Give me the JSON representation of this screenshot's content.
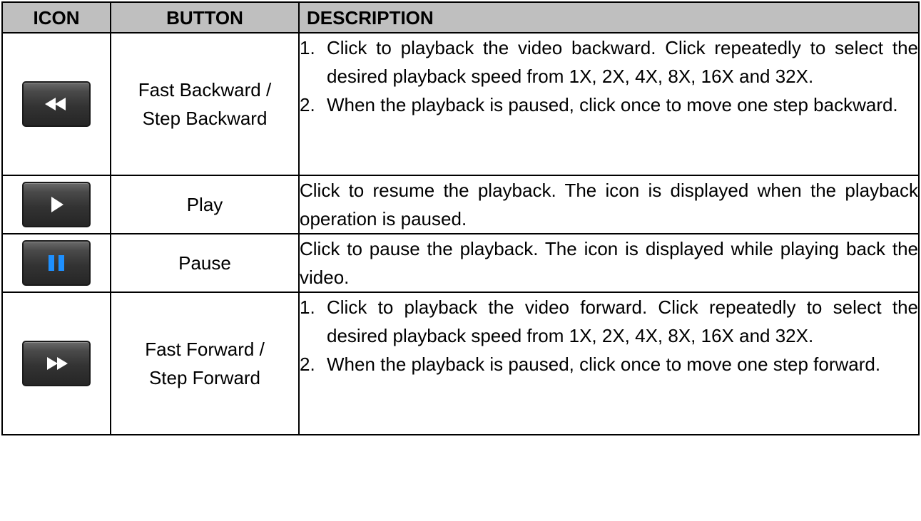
{
  "headers": {
    "icon": "ICON",
    "button": "BUTTON",
    "description": "DESCRIPTION"
  },
  "rows": [
    {
      "icon": "rewind-icon",
      "button": "Fast Backward / Step Backward",
      "button_lines": [
        "Fast Backward /",
        "Step Backward"
      ],
      "items": [
        {
          "num": "1.",
          "text": "Click to playback the video backward. Click repeatedly to select the desired playback speed from 1X, 2X, 4X, 8X, 16X and 32X."
        },
        {
          "num": "2.",
          "text": "When the playback is paused, click once to move one step backward."
        }
      ]
    },
    {
      "icon": "play-icon",
      "button": "Play",
      "text": "Click to resume the playback. The icon is displayed when the playback operation is paused."
    },
    {
      "icon": "pause-icon",
      "button": "Pause",
      "text": "Click to pause the playback. The icon is displayed while playing back the video."
    },
    {
      "icon": "fast-forward-icon",
      "button": "Fast Forward / Step Forward",
      "button_lines": [
        "Fast Forward /",
        "Step Forward"
      ],
      "items": [
        {
          "num": "1.",
          "text": "Click to playback the video forward. Click repeatedly to select the desired playback speed from 1X, 2X, 4X, 8X, 16X and 32X."
        },
        {
          "num": "2.",
          "text": "When the playback is paused, click once to move one step forward."
        }
      ]
    }
  ],
  "colors": {
    "header_bg": "#bfbfbf",
    "pause_accent": "#1e90ff",
    "icon_glyph": "#ffffff"
  }
}
